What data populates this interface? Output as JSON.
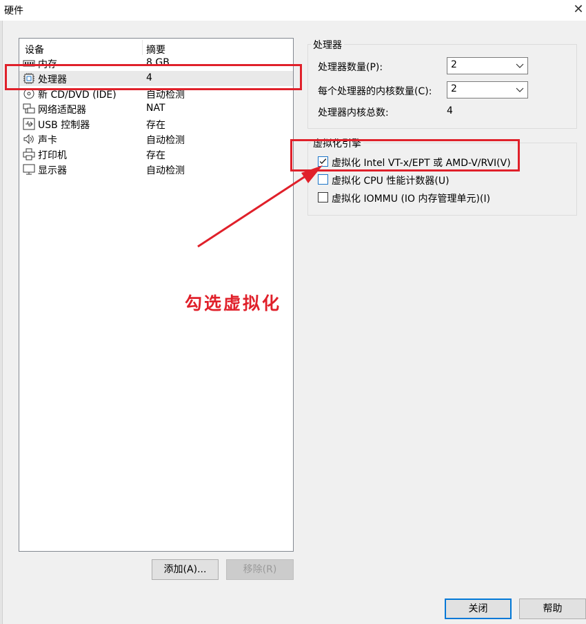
{
  "window": {
    "title": "硬件",
    "close_glyph": "✕"
  },
  "device_list": {
    "columns": [
      "设备",
      "摘要"
    ],
    "rows": [
      {
        "icon": "memory-icon",
        "name": "内存",
        "summary": "8 GB"
      },
      {
        "icon": "processor-icon",
        "name": "处理器",
        "summary": "4",
        "selected": true
      },
      {
        "icon": "disc-icon",
        "name": "新 CD/DVD (IDE)",
        "summary": "自动检测"
      },
      {
        "icon": "network-icon",
        "name": "网络适配器",
        "summary": "NAT"
      },
      {
        "icon": "usb-icon",
        "name": "USB 控制器",
        "summary": "存在"
      },
      {
        "icon": "speaker-icon",
        "name": "声卡",
        "summary": "自动检测"
      },
      {
        "icon": "printer-icon",
        "name": "打印机",
        "summary": "存在"
      },
      {
        "icon": "monitor-icon",
        "name": "显示器",
        "summary": "自动检测"
      }
    ]
  },
  "buttons": {
    "add": "添加(A)...",
    "remove": "移除(R)",
    "close": "关闭",
    "help": "帮助"
  },
  "processor_group": {
    "legend": "处理器",
    "count_label": "处理器数量(P):",
    "count_value": "2",
    "cores_label": "每个处理器的内核数量(C):",
    "cores_value": "2",
    "total_label": "处理器内核总数:",
    "total_value": "4"
  },
  "virtualization_group": {
    "legend": "虚拟化引擎",
    "options": [
      {
        "label": "虚拟化 Intel VT-x/EPT 或 AMD-V/RVI(V)",
        "checked": true
      },
      {
        "label": "虚拟化 CPU 性能计数器(U)",
        "checked": false
      },
      {
        "label": "虚拟化 IOMMU (IO 内存管理单元)(I)",
        "checked": false
      }
    ]
  },
  "annotation": {
    "text": "勾选虚拟化",
    "color": "#e0202a"
  },
  "colors": {
    "highlight": "#e0202a",
    "accent": "#0078d7",
    "selection": "#e9e9e9"
  }
}
